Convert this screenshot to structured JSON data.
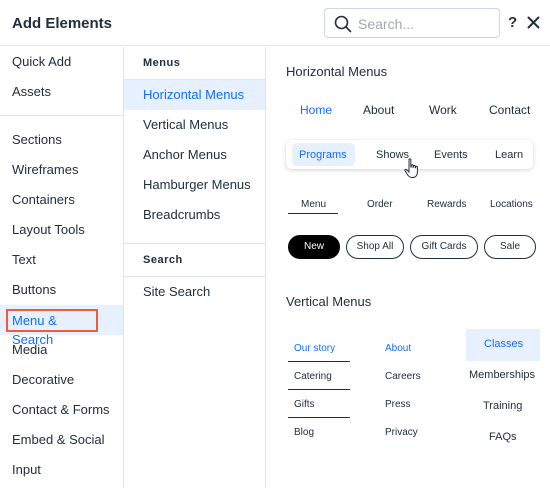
{
  "header": {
    "title": "Add Elements",
    "search_placeholder": "Search...",
    "help": "?"
  },
  "categories": [
    "Quick Add",
    "Assets",
    "Sections",
    "Wireframes",
    "Containers",
    "Layout Tools",
    "Text",
    "Buttons",
    "Menu & Search",
    "Media",
    "Decorative",
    "Contact & Forms",
    "Embed & Social",
    "Input"
  ],
  "subcategories": {
    "menus_header": "Menus",
    "menus": [
      "Horizontal Menus",
      "Vertical Menus",
      "Anchor Menus",
      "Hamburger Menus",
      "Breadcrumbs"
    ],
    "search_header": "Search",
    "search": [
      "Site Search"
    ]
  },
  "preview": {
    "horizontal_heading": "Horizontal Menus",
    "menu1": [
      "Home",
      "About",
      "Work",
      "Contact"
    ],
    "menu2": [
      "Programs",
      "Shows",
      "Events",
      "Learn"
    ],
    "menu3": [
      "Menu",
      "Order",
      "Rewards",
      "Locations"
    ],
    "menu4": [
      "New",
      "Shop All",
      "Gift Cards",
      "Sale"
    ],
    "vertical_heading": "Vertical Menus",
    "vmenu1": [
      "Our story",
      "Catering",
      "Gifts",
      "Blog"
    ],
    "vmenu2": [
      "About",
      "Careers",
      "Press",
      "Privacy"
    ],
    "vmenu3": [
      "Classes",
      "Memberships",
      "Training",
      "FAQs"
    ]
  },
  "colors": {
    "accent": "#116dff",
    "selected_bg": "#e7f0ff",
    "highlight_border": "#f05b3f"
  }
}
